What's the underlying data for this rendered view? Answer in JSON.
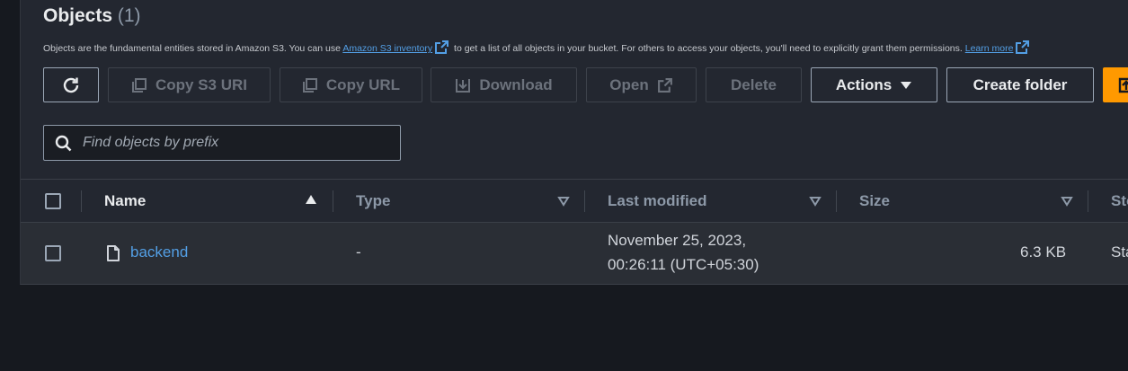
{
  "header": {
    "title": "Objects",
    "count": "(1)",
    "description_pre": "Objects are the fundamental entities stored in Amazon S3. You can use ",
    "inventory_link": "Amazon S3 inventory",
    "description_mid": " to get a list of all objects in your bucket. For others to access your objects, you'll need to explicitly grant them permissions. ",
    "learn_more": "Learn more"
  },
  "toolbar": {
    "refresh_icon": "refresh-icon",
    "copy_s3_uri": "Copy S3 URI",
    "copy_url": "Copy URL",
    "download": "Download",
    "open": "Open",
    "delete": "Delete",
    "actions": "Actions",
    "create_folder": "Create folder"
  },
  "search": {
    "placeholder": "Find objects by prefix"
  },
  "table": {
    "columns": [
      "Name",
      "Type",
      "Last modified",
      "Size",
      "Sto"
    ],
    "rows": [
      {
        "name": "backend",
        "type": "-",
        "last_modified_line1": "November 25, 2023,",
        "last_modified_line2": "00:26:11 (UTC+05:30)",
        "size": "6.3 KB",
        "storage": "Sta"
      }
    ]
  },
  "colors": {
    "accent": "#ff9900",
    "link": "#539fe5",
    "background": "#16191f",
    "panel": "#232730"
  }
}
